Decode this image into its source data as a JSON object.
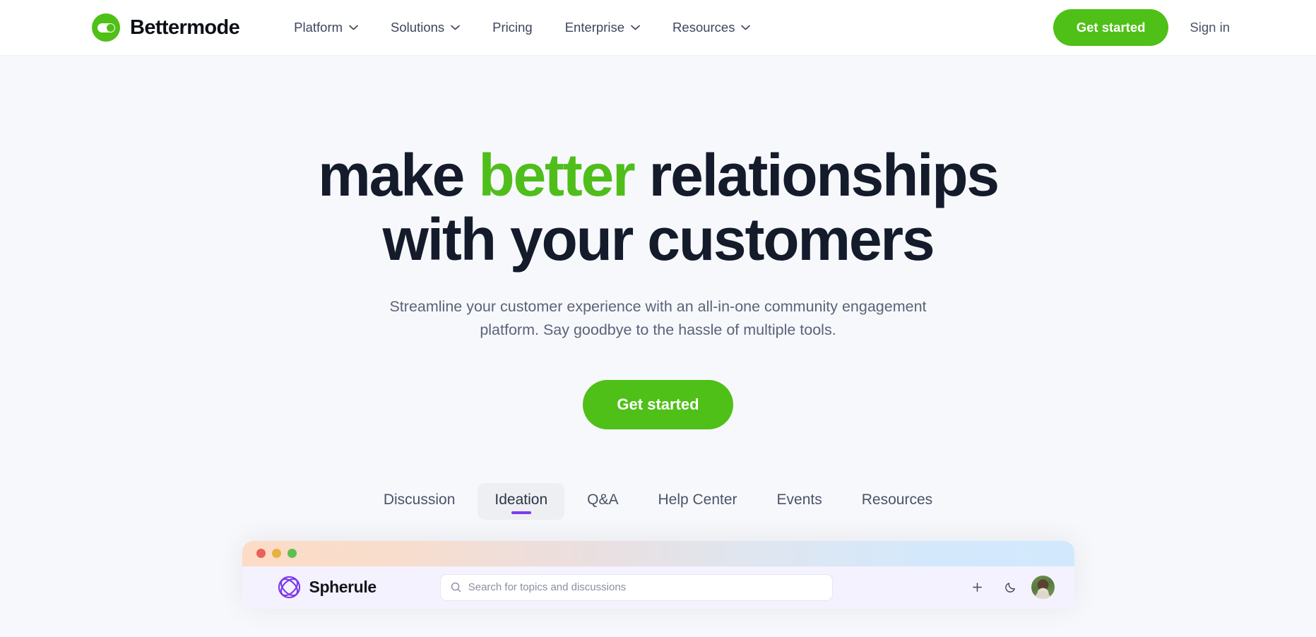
{
  "header": {
    "brand": {
      "name": "Bettermode",
      "logo_icon": "toggle-switch-icon",
      "accent_color": "#4fc017"
    },
    "nav": [
      {
        "label": "Platform",
        "has_dropdown": true,
        "icon": "chevron-down-icon"
      },
      {
        "label": "Solutions",
        "has_dropdown": true,
        "icon": "chevron-down-icon"
      },
      {
        "label": "Pricing",
        "has_dropdown": false,
        "icon": ""
      },
      {
        "label": "Enterprise",
        "has_dropdown": true,
        "icon": "chevron-down-icon"
      },
      {
        "label": "Resources",
        "has_dropdown": true,
        "icon": "chevron-down-icon"
      }
    ],
    "cta_label": "Get started",
    "signin_label": "Sign in"
  },
  "hero": {
    "title_part1": "make ",
    "title_accent": "better",
    "title_part2": " relationships",
    "title_line2": "with your customers",
    "accent_color": "#4fbe1b",
    "subtitle": "Streamline your customer experience with an all-in-one community engagement platform. Say goodbye to the hassle of multiple tools.",
    "cta_label": "Get started"
  },
  "tabs": {
    "active_index": 1,
    "indicator_color": "#7c3aed",
    "items": [
      {
        "label": "Discussion"
      },
      {
        "label": "Ideation"
      },
      {
        "label": "Q&A"
      },
      {
        "label": "Help Center"
      },
      {
        "label": "Events"
      },
      {
        "label": "Resources"
      }
    ]
  },
  "mockup": {
    "window_dots": [
      {
        "name": "close-dot",
        "color": "#e8615a"
      },
      {
        "name": "minimize-dot",
        "color": "#e9b13e"
      },
      {
        "name": "maximize-dot",
        "color": "#5cbf4e"
      }
    ],
    "brand_name": "Spherule",
    "brand_logo_icon": "spherule-logo-icon",
    "brand_color": "#7c3aed",
    "search_placeholder": "Search for topics and discussions",
    "search_icon": "search-icon",
    "actions": [
      {
        "name": "add-button",
        "icon": "plus-icon"
      },
      {
        "name": "dark-mode-toggle",
        "icon": "moon-icon"
      }
    ],
    "avatar_name": "user-avatar"
  }
}
